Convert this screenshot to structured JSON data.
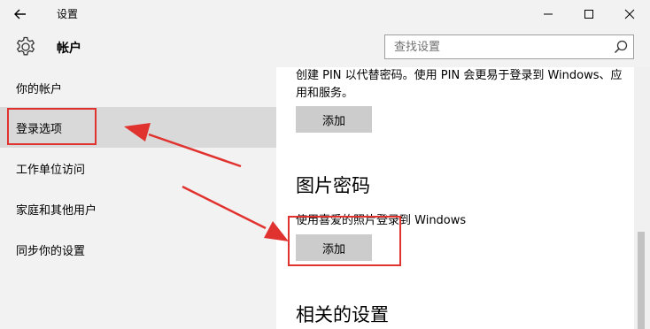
{
  "window": {
    "back_icon": "arrow-left-icon",
    "title": "设置",
    "minimize_icon": "minimize-icon",
    "maximize_icon": "maximize-icon",
    "close_icon": "close-icon"
  },
  "header": {
    "icon": "gear-icon",
    "title": "帐户",
    "search_placeholder": "查找设置",
    "search_icon": "search-icon"
  },
  "sidebar": {
    "items": [
      {
        "label": "你的帐户",
        "selected": false
      },
      {
        "label": "登录选项",
        "selected": true
      },
      {
        "label": "工作单位访问",
        "selected": false
      },
      {
        "label": "家庭和其他用户",
        "selected": false
      },
      {
        "label": "同步你的设置",
        "selected": false
      }
    ]
  },
  "content": {
    "pin": {
      "description": "创建 PIN 以代替密码。使用 PIN 会更易于登录到 Windows、应用和服务。",
      "button_label": "添加"
    },
    "picture_password": {
      "title": "图片密码",
      "description": "使用喜爱的照片登录到 Windows",
      "button_label": "添加"
    },
    "related": {
      "title": "相关的设置"
    }
  },
  "annotation_color": "#e0322f"
}
